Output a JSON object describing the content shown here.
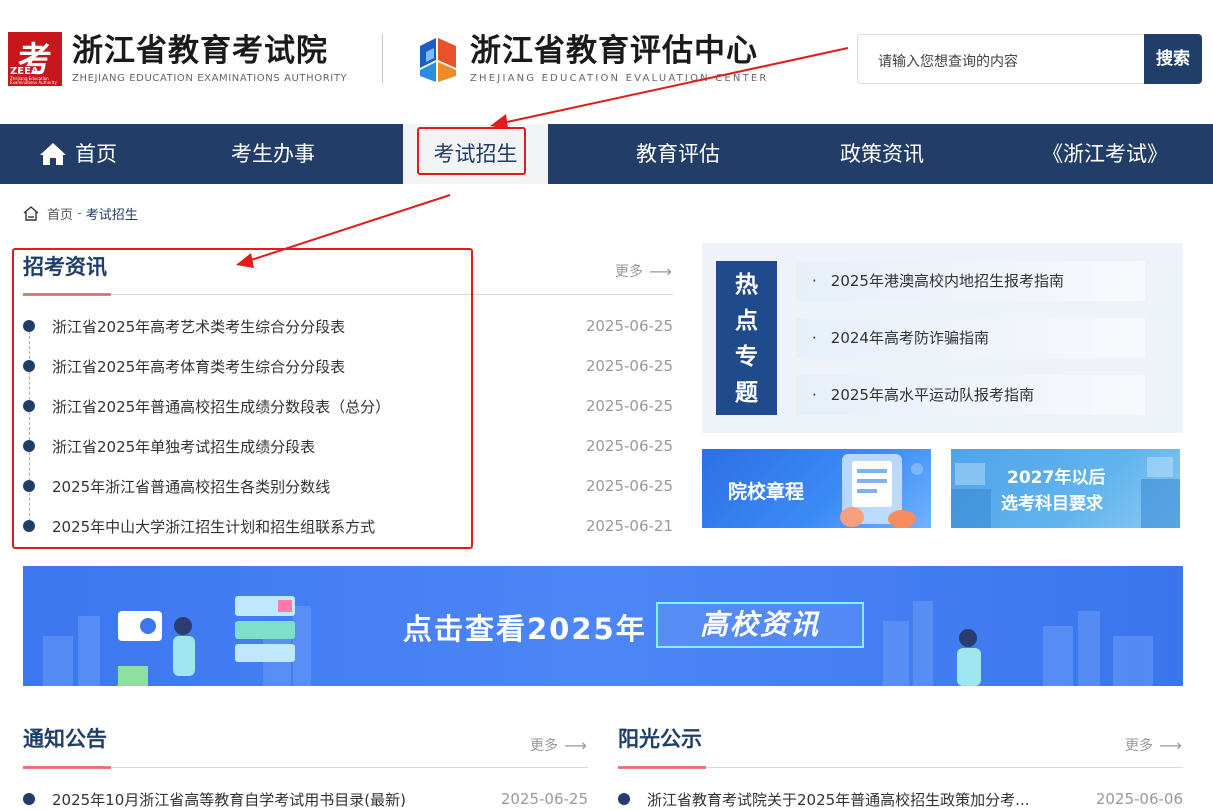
{
  "header": {
    "logo1_mark": "考",
    "logo1_mark_text": "ZEEA",
    "logo1_mark_small": "Zhejiang Education Examinations Authority",
    "logo1_cn": "浙江省教育考试院",
    "logo1_en": "ZHEJIANG EDUCATION EXAMINATIONS AUTHORITY",
    "logo2_cn": "浙江省教育评估中心",
    "logo2_en": "ZHEJIANG EDUCATION EVALUATION CENTER",
    "search_placeholder": "请输入您想查询的内容",
    "search_button": "搜索"
  },
  "nav": {
    "items": [
      "首页",
      "考生办事",
      "考试招生",
      "教育评估",
      "政策资讯",
      "《浙江考试》"
    ],
    "active": "考试招生"
  },
  "breadcrumb": {
    "home": "首页",
    "sep": "-",
    "current": "考试招生"
  },
  "admissions": {
    "title": "招考资讯",
    "more": "更多",
    "items": [
      {
        "title": "浙江省2025年高考艺术类考生综合分分段表",
        "date": "2025-06-25"
      },
      {
        "title": "浙江省2025年高考体育类考生综合分分段表",
        "date": "2025-06-25"
      },
      {
        "title": "浙江省2025年普通高校招生成绩分数段表（总分）",
        "date": "2025-06-25"
      },
      {
        "title": "浙江省2025年单独考试招生成绩分段表",
        "date": "2025-06-25"
      },
      {
        "title": "2025年浙江省普通高校招生各类别分数线",
        "date": "2025-06-25"
      },
      {
        "title": "2025年中山大学浙江招生计划和招生组联系方式",
        "date": "2025-06-21"
      }
    ]
  },
  "hot": {
    "label": [
      "热",
      "点",
      "专",
      "题"
    ],
    "bullet": "·",
    "items": [
      "2025年港澳高校内地招生报考指南",
      "2024年高考防诈骗指南",
      "2025年高水平运动队报考指南"
    ]
  },
  "promos": {
    "p1": "院校章程",
    "p2_line1": "2027年以后",
    "p2_line2": "选考科目要求"
  },
  "banner": {
    "text": "点击查看2025年",
    "boxed": "高校资讯"
  },
  "notices": {
    "title": "通知公告",
    "more": "更多",
    "items": [
      {
        "title": "2025年10月浙江省高等教育自学考试用书目录(最新)",
        "date": "2025-06-25"
      }
    ]
  },
  "sunshine": {
    "title": "阳光公示",
    "more": "更多",
    "items": [
      {
        "title": "浙江省教育考试院关于2025年普通高校招生政策加分考...",
        "date": "2025-06-06"
      }
    ]
  },
  "colors": {
    "navy": "#223e68",
    "accent_red": "#e31b1b",
    "hot_blue": "#1f4a8c"
  }
}
